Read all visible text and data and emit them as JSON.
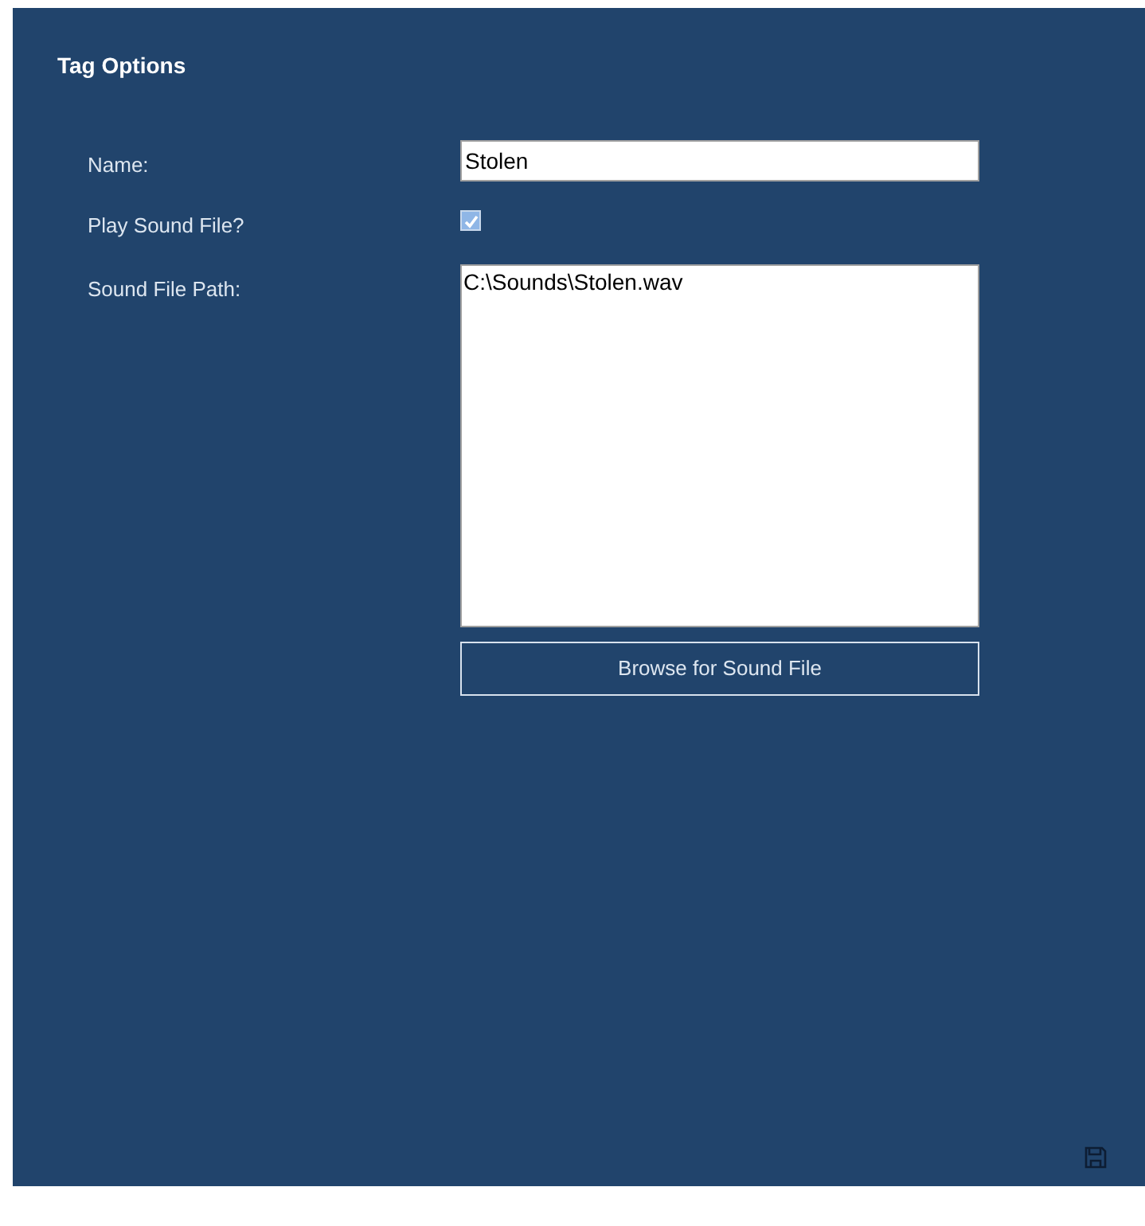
{
  "title": "Tag Options",
  "fields": [
    {
      "kind": "text",
      "label": "Name:",
      "value": "Stolen"
    },
    {
      "kind": "checkbox",
      "label": "Play Sound File?",
      "checked": true
    },
    {
      "kind": "textarea",
      "label": "Sound File Path:",
      "value": "C:\\Sounds\\Stolen.wav"
    }
  ],
  "browse_button": "Browse for Sound File"
}
